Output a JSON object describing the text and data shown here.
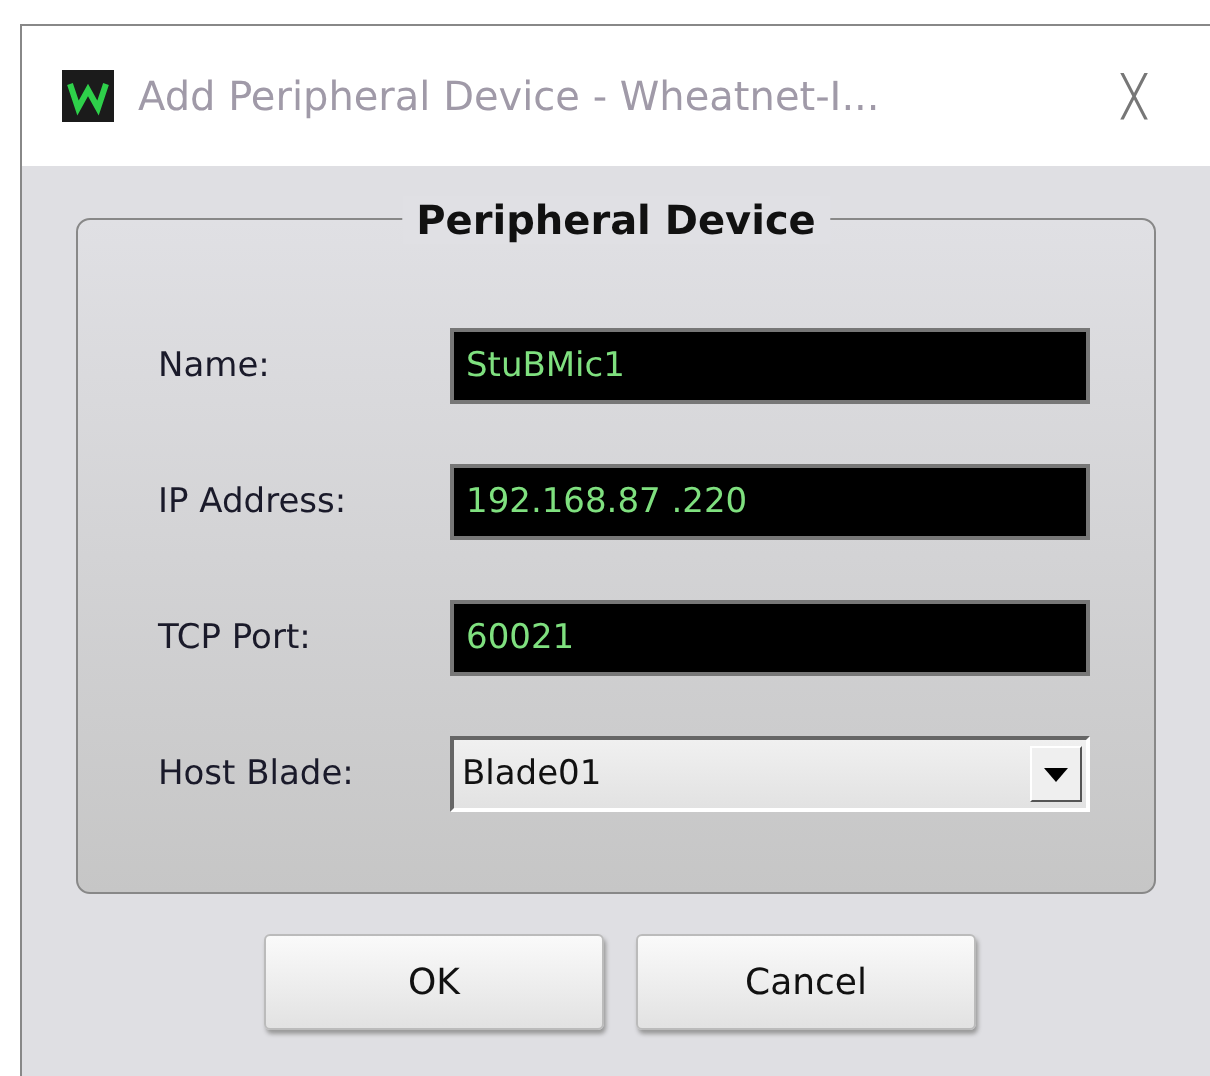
{
  "window": {
    "title": "Add Peripheral Device - Wheatnet-I...",
    "close": "╳"
  },
  "group": {
    "title": "Peripheral Device"
  },
  "fields": [
    {
      "kind": "text",
      "label": "Name:",
      "value": "StuBMic1"
    },
    {
      "kind": "text",
      "label": "IP Address:",
      "value": "192.168.87 .220"
    },
    {
      "kind": "text",
      "label": "TCP Port:",
      "value": "60021"
    },
    {
      "kind": "dropdown",
      "label": "Host Blade:",
      "value": "Blade01"
    }
  ],
  "buttons": [
    "OK",
    "Cancel"
  ]
}
